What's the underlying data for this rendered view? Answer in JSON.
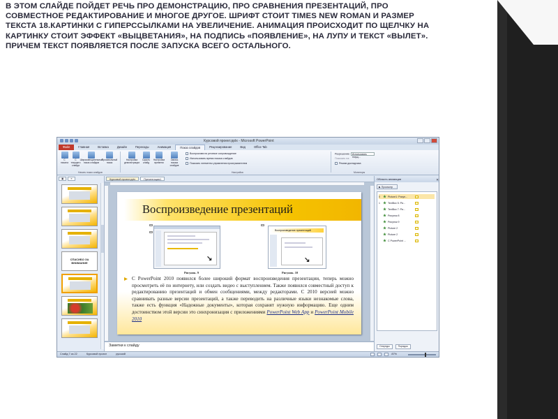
{
  "slide_text": "В этом слайде пойдет речь про демонстрацию, про сравнения презентаций, про совместное редактирование и многое другое. Шрифт стоит Times New Roman и размер текста 18.Картинки с гиперссылками на увеличение. Анимация происходит по щелчку на картинку стоит эффект «выцветания», на подпись «появление», на лупу и текст «вылет». Причем текст появляется после запуска всего остального.",
  "app": {
    "window_title": "Курсовой проект.pptx - Microsoft PowerPoint",
    "tabs": [
      "Файл",
      "Главная",
      "Вставка",
      "Дизайн",
      "Переходы",
      "Анимация",
      "Показ слайдов",
      "Рецензирование",
      "Вид",
      "Office Tab"
    ],
    "active_tab": "Показ слайдов",
    "ribbon": {
      "buttons": [
        "С начала",
        "С текущего слайда",
        "Широковещательный показ слайдов",
        "Произвольный показ",
        "Настройка демонстрации",
        "Скрыть слайд",
        "Настройка времени",
        "Запись показа слайдов"
      ],
      "checkboxes": [
        "Воспроизвести речевое сопровождение",
        "Использовать время показа слайдов",
        "Показать элементы управления проигрывателем"
      ],
      "monitor_labels": [
        "Разрешение:",
        "Показать на:",
        "Режим докладчика"
      ],
      "resolution_value": "Использовать текущ...",
      "groups": [
        "Начать показ слайдов",
        "Настройка",
        "Мониторы"
      ]
    },
    "doc_tabs": [
      "Курсовой проект.pptx",
      "Презентация1"
    ],
    "thumbnail_numbers": [
      "18",
      "19",
      "20",
      "21",
      "22",
      "23",
      "24"
    ],
    "thumbnail_end_text": "СПАСИБО ЗА ВНИМАНИЕ",
    "slide": {
      "title": "Воспроизведение презентаций",
      "caption_left": "Рисунок. 9",
      "caption_right": "Рисунок. 10",
      "card_title": "Воспроизведение презентаций",
      "body_text": "С PowerPoint 2010 появился более широкий формат воспроизведения презентации, теперь можно просмотреть её по интернету, или создать видео с выступлением. Также появился совместный доступ к редактированию презентаций и обмен сообщениями, между редакторами. С 2010 версией можно сравнивать разные версии презентаций, а также переводить на различные языки незнакомые слова, также есть функция «Надежные документы», которая сохранят нужную информацию. Еще одним достоинством этой версии это синхронизация с приложениями",
      "link1": "PowerPoint Web App",
      "link_join": " и ",
      "link2": "PowerPoint Mobile 2010"
    },
    "notes_placeholder": "Заметки к слайду",
    "animation_pane": {
      "title": "Область анимации",
      "play_button": "▶ Просмотр",
      "items": [
        {
          "n": "0",
          "label": "Picture1: Рисун..."
        },
        {
          "n": "1",
          "label": "TextBox 5: Ри..."
        },
        {
          "n": "",
          "label": "TextBox 7: Ри..."
        },
        {
          "n": "",
          "label": "Рисунок 8"
        },
        {
          "n": "",
          "label": "Рисунок 9"
        },
        {
          "n": "",
          "label": "Picture 2"
        },
        {
          "n": "",
          "label": "Picture 2"
        },
        {
          "n": "",
          "label": "С PowerPoint ..."
        }
      ],
      "footer_left": "Секунды",
      "footer_order": "Порядок"
    },
    "status": {
      "slide": "Слайд 7 из 22",
      "theme": "Курсовой проект",
      "lang": "русский",
      "zoom": "87%"
    }
  }
}
